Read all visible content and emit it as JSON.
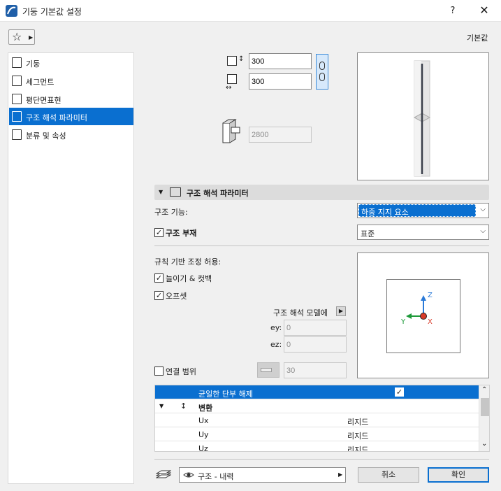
{
  "window": {
    "title": "기둥 기본값 설정",
    "help": "?",
    "close": "✕"
  },
  "toolbar": {
    "star": "☆",
    "arrow": "▶",
    "default_label": "기본값"
  },
  "sidebar": {
    "items": [
      {
        "label": "기둥",
        "active": false
      },
      {
        "label": "세그먼트",
        "active": false
      },
      {
        "label": "평단면표현",
        "active": false
      },
      {
        "label": "구조 해석 파라미터",
        "active": true
      },
      {
        "label": "분류 및 속성",
        "active": false
      }
    ]
  },
  "dimensions": {
    "width": "300",
    "depth": "300",
    "height": "2800"
  },
  "section": {
    "caret": "▼",
    "title": "구조 해석 파라미터"
  },
  "structural_function": {
    "label": "구조 기능:",
    "value": "하중 지지 요소",
    "arrow": "⌵"
  },
  "structural_member": {
    "label": "구조 부재",
    "checked": true,
    "value": "표준",
    "arrow": "⌵"
  },
  "rules": {
    "label": "규칙 기반 조정 허용:",
    "extend_label": "늘이기 & 컷백",
    "extend_checked": true,
    "offset_label": "오프셋",
    "offset_checked": true,
    "model_label": "구조 해석 모델에",
    "model_arrow": "▶",
    "ey_label": "ey:",
    "ey_value": "0",
    "ez_label": "ez:",
    "ez_value": "0",
    "connection_label": "연결 범위",
    "connection_checked": false,
    "connection_value": "30"
  },
  "axes": {
    "z": "Z",
    "y": "Y",
    "x": "X"
  },
  "table": {
    "rows": [
      {
        "c1": "균일한 단부 해제",
        "c2": "✓",
        "selected": true
      },
      {
        "c1": "변환",
        "c2": "",
        "group": true
      },
      {
        "c1": "Ux",
        "c2": "리지드"
      },
      {
        "c1": "Uy",
        "c2": "리지드"
      },
      {
        "c1": "Uz",
        "c2": "리지드"
      }
    ],
    "group_caret": "▼",
    "group_icon": "↕",
    "scroll_up": "⌃",
    "scroll_down": "⌄"
  },
  "footer": {
    "view_label": "구조 - 내력",
    "view_arrow": "▶",
    "cancel": "취소",
    "ok": "확인"
  },
  "colors": {
    "accent": "#0a6fd0",
    "axis_z": "#2a7ad8",
    "axis_y": "#1e9a3a",
    "axis_x": "#d83a2a"
  }
}
